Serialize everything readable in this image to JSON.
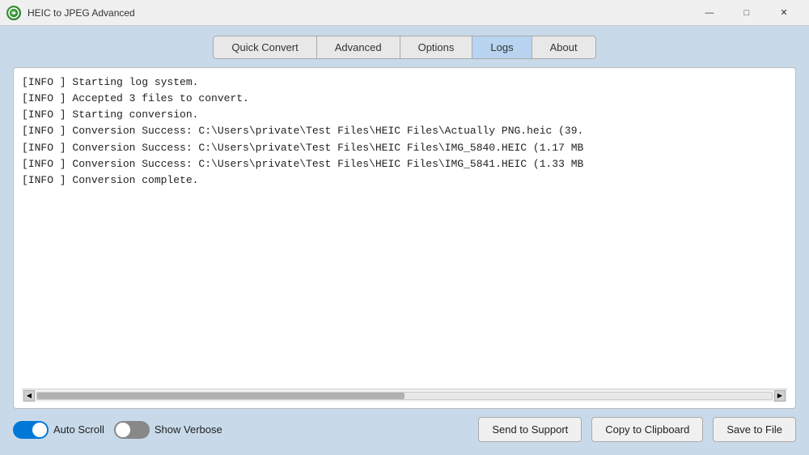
{
  "window": {
    "title": "HEIC to JPEG Advanced",
    "controls": {
      "minimize": "—",
      "maximize": "□",
      "close": "✕"
    }
  },
  "tabs": [
    {
      "id": "quick-convert",
      "label": "Quick Convert",
      "active": false
    },
    {
      "id": "advanced",
      "label": "Advanced",
      "active": false
    },
    {
      "id": "options",
      "label": "Options",
      "active": false
    },
    {
      "id": "logs",
      "label": "Logs",
      "active": true
    },
    {
      "id": "about",
      "label": "About",
      "active": false
    }
  ],
  "log": {
    "lines": [
      "[INFO    ] Starting log system.",
      "[INFO    ] Accepted 3 files to convert.",
      "[INFO    ] Starting conversion.",
      "[INFO    ] Conversion Success: C:\\Users\\private\\Test Files\\HEIC Files\\Actually PNG.heic (39.",
      "[INFO    ] Conversion Success: C:\\Users\\private\\Test Files\\HEIC Files\\IMG_5840.HEIC (1.17 MB",
      "[INFO    ] Conversion Success: C:\\Users\\private\\Test Files\\HEIC Files\\IMG_5841.HEIC (1.33 MB",
      "[INFO    ] Conversion complete."
    ]
  },
  "controls": {
    "auto_scroll_label": "Auto Scroll",
    "auto_scroll_on": true,
    "show_verbose_label": "Show Verbose",
    "show_verbose_on": false,
    "send_to_support_label": "Send to Support",
    "copy_to_clipboard_label": "Copy to Clipboard",
    "save_to_file_label": "Save to File"
  },
  "colors": {
    "accent": "#0078d7",
    "tab_active_bg": "#b8d4f0"
  }
}
